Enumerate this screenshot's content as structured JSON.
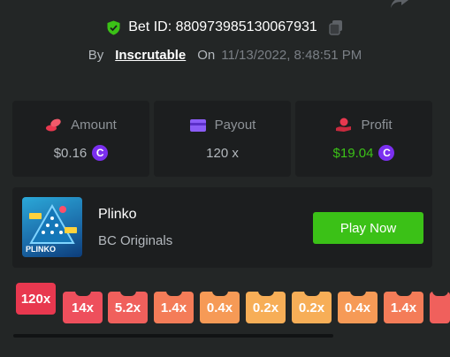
{
  "bet": {
    "id_text": "Bet ID: 880973985130067931",
    "by_label": "By",
    "user": "Inscrutable",
    "on_label": "On",
    "date": "11/13/2022, 8:48:51 PM"
  },
  "stats": [
    {
      "label": "Amount",
      "value": "$0.16",
      "icon": "coins-icon",
      "coin": "C"
    },
    {
      "label": "Payout",
      "value": "120 x",
      "icon": "card-icon"
    },
    {
      "label": "Profit",
      "value": "$19.04",
      "icon": "profit-icon",
      "coin": "C"
    }
  ],
  "game": {
    "name": "Plinko",
    "provider": "BC Originals",
    "thumb_label": "PLINKO",
    "play_label": "Play Now"
  },
  "multipliers": [
    {
      "label": "120x",
      "color": "#e8384f"
    },
    {
      "label": "14x",
      "color": "#ee4f5c"
    },
    {
      "label": "5.2x",
      "color": "#f0605c"
    },
    {
      "label": "1.4x",
      "color": "#f47c58"
    },
    {
      "label": "0.4x",
      "color": "#f69a56"
    },
    {
      "label": "0.2x",
      "color": "#f7ae57"
    },
    {
      "label": "0.2x",
      "color": "#f7ae57"
    },
    {
      "label": "0.4x",
      "color": "#f69a56"
    },
    {
      "label": "1.4x",
      "color": "#f47c58"
    },
    {
      "label": "",
      "color": "#f0605c"
    }
  ],
  "colors": {
    "accent_green": "#3bc117",
    "coin_purple": "#7b2ff0",
    "background": "#232626",
    "card": "#1c1e1f"
  }
}
